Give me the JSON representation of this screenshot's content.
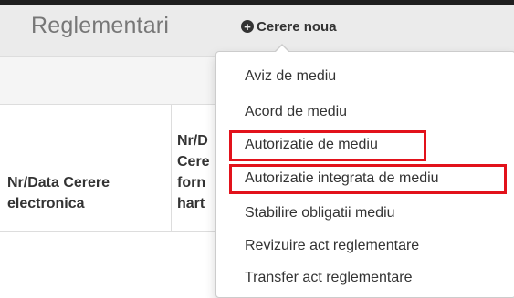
{
  "header": {
    "title": "Reglementari",
    "new_request_label": "Cerere noua",
    "new_request_icon": "plus-circle-icon"
  },
  "table": {
    "headers": [
      {
        "lines": [
          "Nr/Data Cerere",
          "electronica"
        ]
      },
      {
        "lines": [
          "Nr/D",
          "Cere",
          "forn",
          "hart"
        ]
      }
    ]
  },
  "dropdown": {
    "items": [
      {
        "label": "Aviz de mediu",
        "highlighted": false
      },
      {
        "label": "Acord de mediu",
        "highlighted": false
      },
      {
        "label": "Autorizatie de mediu",
        "highlighted": true
      },
      {
        "label": "Autorizatie integrata de mediu",
        "highlighted": true
      },
      {
        "label": "Stabilire obligatii mediu",
        "highlighted": false
      },
      {
        "label": "Revizuire act reglementare",
        "highlighted": false
      },
      {
        "label": "Transfer act reglementare",
        "highlighted": false
      }
    ]
  },
  "colors": {
    "highlight_border": "#e2121b",
    "navbar_bg": "#ebebeb",
    "text": "#333333"
  }
}
